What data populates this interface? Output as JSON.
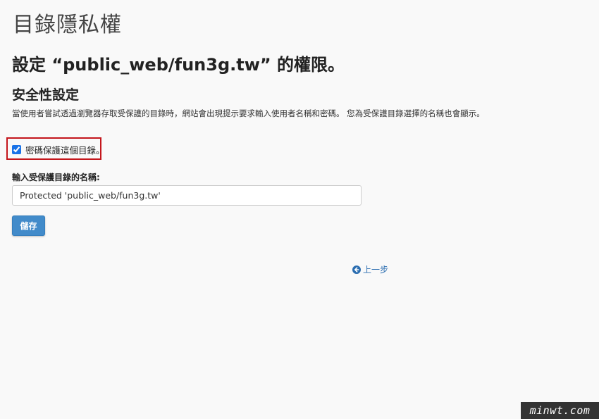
{
  "page": {
    "title": "目錄隱私權",
    "heading": "設定 “public_web/fun3g.tw” 的權限。",
    "section_title": "安全性設定",
    "description": "當使用者嘗試透過瀏覽器存取受保護的目錄時，網站會出現提示要求輸入使用者名稱和密碼。 您為受保護目錄選擇的名稱也會顯示。"
  },
  "form": {
    "protect_checkbox_label": "密碼保護這個目錄。",
    "protect_checked": true,
    "name_label": "輸入受保護目錄的名稱:",
    "name_value": "Protected 'public_web/fun3g.tw'",
    "save_label": "儲存"
  },
  "navigation": {
    "back_label": "上一步",
    "back_icon": "arrow-left-circle-icon"
  },
  "watermark": {
    "text": "minwt.com"
  },
  "colors": {
    "accent": "#428bca",
    "highlight_border": "#c4161c",
    "link": "#2a6db0"
  }
}
